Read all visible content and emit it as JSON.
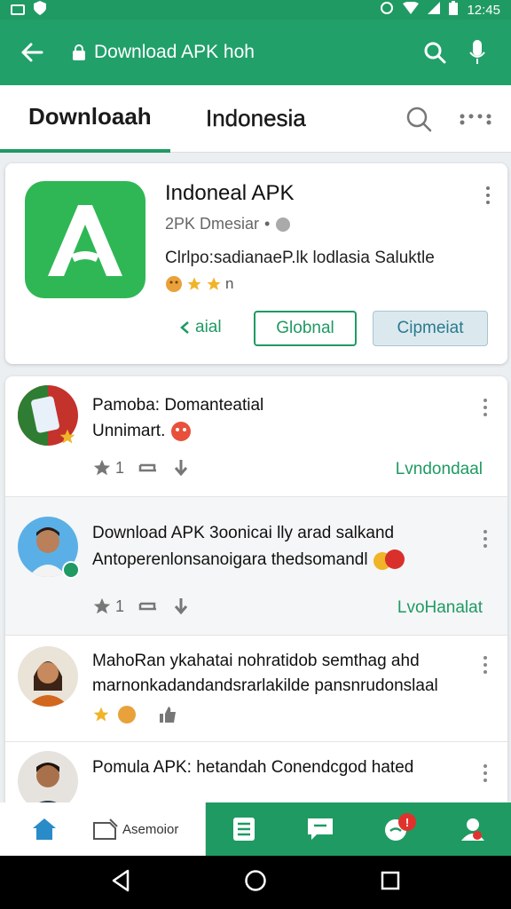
{
  "status_bar": {
    "time": "12:45"
  },
  "app_bar": {
    "title": "Download APK hoh"
  },
  "tabs": [
    {
      "label": "Downloaah"
    },
    {
      "label": "Indonesia"
    }
  ],
  "app_card": {
    "name": "Indoneal APK",
    "subtitle": "2PK Dmesiar",
    "description": "Clrlpo:sadianaeP.lk lodlasia Saluktle",
    "rating_label": "n",
    "btn_text": "aial",
    "btn_outline": "Globnal",
    "btn_filled": "Cipmeiat"
  },
  "posts": [
    {
      "line1": "Pamoba: Domanteatial",
      "line2": "Unnimart.",
      "star_count": "1",
      "link": "Lvndondaal"
    },
    {
      "line1": "Download APK 3oonicai lly arad salkand",
      "line2": "Antoperenlonsanoigara thedsomandl",
      "star_count": "1",
      "link": "LvoHanalat"
    },
    {
      "line1": "MahoRan ykahatai nohratidob semthag ahd",
      "line2": "marnonkadandandsrarlakilde pansnrudonslaal"
    },
    {
      "line1": "Pomula APK: hetandah Conendcgod hated"
    }
  ],
  "bottom_nav": {
    "asemor_label": "Asemoior",
    "badge": "!"
  },
  "colors": {
    "primary": "#21a06a",
    "accent": "#1f9a63"
  }
}
